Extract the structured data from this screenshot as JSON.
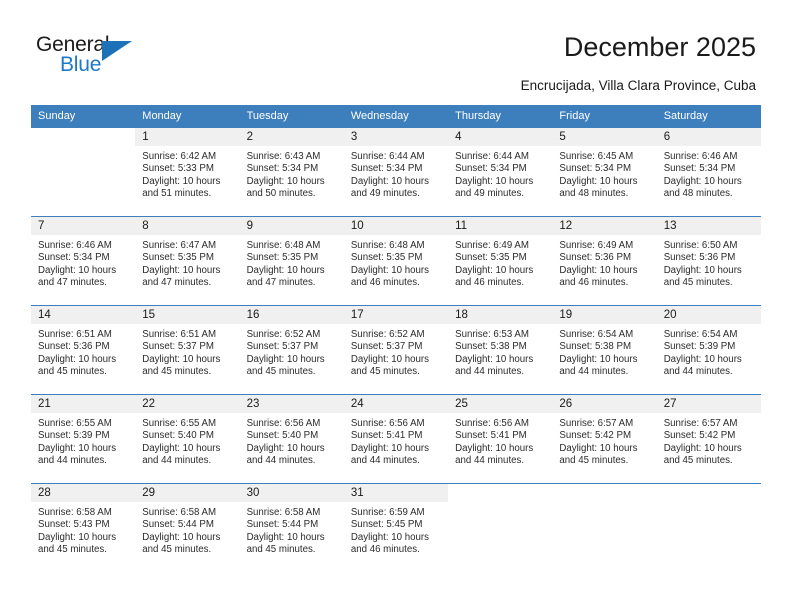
{
  "brand": {
    "name_part1": "General",
    "name_part2": "Blue",
    "triangle_color": "#1d71b8",
    "blue_text_color": "#2079c7"
  },
  "header": {
    "title": "December 2025",
    "subtitle": "Encrucijada, Villa Clara Province, Cuba"
  },
  "theme": {
    "header_bg": "#3d7ebd",
    "daynum_bg": "#f0f0f0",
    "grid_line": "#3d7ebd"
  },
  "calendar": {
    "weekdays": [
      "Sunday",
      "Monday",
      "Tuesday",
      "Wednesday",
      "Thursday",
      "Friday",
      "Saturday"
    ],
    "labels": {
      "sunrise": "Sunrise:",
      "sunset": "Sunset:",
      "daylight": "Daylight:"
    },
    "weeks": [
      [
        {
          "day": "",
          "blank": true
        },
        {
          "day": "1",
          "sunrise": "Sunrise: 6:42 AM",
          "sunset": "Sunset: 5:33 PM",
          "daylight1": "Daylight: 10 hours",
          "daylight2": "and 51 minutes."
        },
        {
          "day": "2",
          "sunrise": "Sunrise: 6:43 AM",
          "sunset": "Sunset: 5:34 PM",
          "daylight1": "Daylight: 10 hours",
          "daylight2": "and 50 minutes."
        },
        {
          "day": "3",
          "sunrise": "Sunrise: 6:44 AM",
          "sunset": "Sunset: 5:34 PM",
          "daylight1": "Daylight: 10 hours",
          "daylight2": "and 49 minutes."
        },
        {
          "day": "4",
          "sunrise": "Sunrise: 6:44 AM",
          "sunset": "Sunset: 5:34 PM",
          "daylight1": "Daylight: 10 hours",
          "daylight2": "and 49 minutes."
        },
        {
          "day": "5",
          "sunrise": "Sunrise: 6:45 AM",
          "sunset": "Sunset: 5:34 PM",
          "daylight1": "Daylight: 10 hours",
          "daylight2": "and 48 minutes."
        },
        {
          "day": "6",
          "sunrise": "Sunrise: 6:46 AM",
          "sunset": "Sunset: 5:34 PM",
          "daylight1": "Daylight: 10 hours",
          "daylight2": "and 48 minutes."
        }
      ],
      [
        {
          "day": "7",
          "sunrise": "Sunrise: 6:46 AM",
          "sunset": "Sunset: 5:34 PM",
          "daylight1": "Daylight: 10 hours",
          "daylight2": "and 47 minutes."
        },
        {
          "day": "8",
          "sunrise": "Sunrise: 6:47 AM",
          "sunset": "Sunset: 5:35 PM",
          "daylight1": "Daylight: 10 hours",
          "daylight2": "and 47 minutes."
        },
        {
          "day": "9",
          "sunrise": "Sunrise: 6:48 AM",
          "sunset": "Sunset: 5:35 PM",
          "daylight1": "Daylight: 10 hours",
          "daylight2": "and 47 minutes."
        },
        {
          "day": "10",
          "sunrise": "Sunrise: 6:48 AM",
          "sunset": "Sunset: 5:35 PM",
          "daylight1": "Daylight: 10 hours",
          "daylight2": "and 46 minutes."
        },
        {
          "day": "11",
          "sunrise": "Sunrise: 6:49 AM",
          "sunset": "Sunset: 5:35 PM",
          "daylight1": "Daylight: 10 hours",
          "daylight2": "and 46 minutes."
        },
        {
          "day": "12",
          "sunrise": "Sunrise: 6:49 AM",
          "sunset": "Sunset: 5:36 PM",
          "daylight1": "Daylight: 10 hours",
          "daylight2": "and 46 minutes."
        },
        {
          "day": "13",
          "sunrise": "Sunrise: 6:50 AM",
          "sunset": "Sunset: 5:36 PM",
          "daylight1": "Daylight: 10 hours",
          "daylight2": "and 45 minutes."
        }
      ],
      [
        {
          "day": "14",
          "sunrise": "Sunrise: 6:51 AM",
          "sunset": "Sunset: 5:36 PM",
          "daylight1": "Daylight: 10 hours",
          "daylight2": "and 45 minutes."
        },
        {
          "day": "15",
          "sunrise": "Sunrise: 6:51 AM",
          "sunset": "Sunset: 5:37 PM",
          "daylight1": "Daylight: 10 hours",
          "daylight2": "and 45 minutes."
        },
        {
          "day": "16",
          "sunrise": "Sunrise: 6:52 AM",
          "sunset": "Sunset: 5:37 PM",
          "daylight1": "Daylight: 10 hours",
          "daylight2": "and 45 minutes."
        },
        {
          "day": "17",
          "sunrise": "Sunrise: 6:52 AM",
          "sunset": "Sunset: 5:37 PM",
          "daylight1": "Daylight: 10 hours",
          "daylight2": "and 45 minutes."
        },
        {
          "day": "18",
          "sunrise": "Sunrise: 6:53 AM",
          "sunset": "Sunset: 5:38 PM",
          "daylight1": "Daylight: 10 hours",
          "daylight2": "and 44 minutes."
        },
        {
          "day": "19",
          "sunrise": "Sunrise: 6:54 AM",
          "sunset": "Sunset: 5:38 PM",
          "daylight1": "Daylight: 10 hours",
          "daylight2": "and 44 minutes."
        },
        {
          "day": "20",
          "sunrise": "Sunrise: 6:54 AM",
          "sunset": "Sunset: 5:39 PM",
          "daylight1": "Daylight: 10 hours",
          "daylight2": "and 44 minutes."
        }
      ],
      [
        {
          "day": "21",
          "sunrise": "Sunrise: 6:55 AM",
          "sunset": "Sunset: 5:39 PM",
          "daylight1": "Daylight: 10 hours",
          "daylight2": "and 44 minutes."
        },
        {
          "day": "22",
          "sunrise": "Sunrise: 6:55 AM",
          "sunset": "Sunset: 5:40 PM",
          "daylight1": "Daylight: 10 hours",
          "daylight2": "and 44 minutes."
        },
        {
          "day": "23",
          "sunrise": "Sunrise: 6:56 AM",
          "sunset": "Sunset: 5:40 PM",
          "daylight1": "Daylight: 10 hours",
          "daylight2": "and 44 minutes."
        },
        {
          "day": "24",
          "sunrise": "Sunrise: 6:56 AM",
          "sunset": "Sunset: 5:41 PM",
          "daylight1": "Daylight: 10 hours",
          "daylight2": "and 44 minutes."
        },
        {
          "day": "25",
          "sunrise": "Sunrise: 6:56 AM",
          "sunset": "Sunset: 5:41 PM",
          "daylight1": "Daylight: 10 hours",
          "daylight2": "and 44 minutes."
        },
        {
          "day": "26",
          "sunrise": "Sunrise: 6:57 AM",
          "sunset": "Sunset: 5:42 PM",
          "daylight1": "Daylight: 10 hours",
          "daylight2": "and 45 minutes."
        },
        {
          "day": "27",
          "sunrise": "Sunrise: 6:57 AM",
          "sunset": "Sunset: 5:42 PM",
          "daylight1": "Daylight: 10 hours",
          "daylight2": "and 45 minutes."
        }
      ],
      [
        {
          "day": "28",
          "sunrise": "Sunrise: 6:58 AM",
          "sunset": "Sunset: 5:43 PM",
          "daylight1": "Daylight: 10 hours",
          "daylight2": "and 45 minutes."
        },
        {
          "day": "29",
          "sunrise": "Sunrise: 6:58 AM",
          "sunset": "Sunset: 5:44 PM",
          "daylight1": "Daylight: 10 hours",
          "daylight2": "and 45 minutes."
        },
        {
          "day": "30",
          "sunrise": "Sunrise: 6:58 AM",
          "sunset": "Sunset: 5:44 PM",
          "daylight1": "Daylight: 10 hours",
          "daylight2": "and 45 minutes."
        },
        {
          "day": "31",
          "sunrise": "Sunrise: 6:59 AM",
          "sunset": "Sunset: 5:45 PM",
          "daylight1": "Daylight: 10 hours",
          "daylight2": "and 46 minutes."
        },
        {
          "day": "",
          "blank": true
        },
        {
          "day": "",
          "blank": true
        },
        {
          "day": "",
          "blank": true
        }
      ]
    ]
  }
}
